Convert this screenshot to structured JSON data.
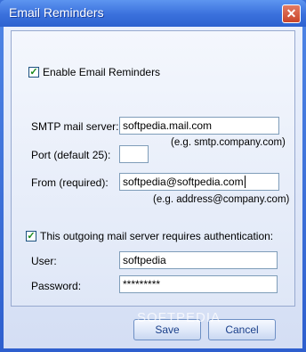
{
  "window": {
    "title": "Email Reminders"
  },
  "enable_reminders": {
    "label": "Enable Email Reminders",
    "checked": true
  },
  "smtp": {
    "label": "SMTP mail server:",
    "value": "softpedia.mail.com",
    "hint": "(e.g. smtp.company.com)"
  },
  "port": {
    "label": "Port (default 25):",
    "value": ""
  },
  "from": {
    "label": "From (required):",
    "value": "softpedia@softpedia.com",
    "hint": "(e.g. address@company.com)"
  },
  "auth": {
    "label": "This outgoing mail server requires authentication:",
    "checked": true
  },
  "user": {
    "label": "User:",
    "value": "softpedia"
  },
  "password": {
    "label": "Password:",
    "value": "*********"
  },
  "buttons": {
    "save": "Save",
    "cancel": "Cancel"
  },
  "watermark": "SOFTPEDIA",
  "icons": {
    "mascot": "yellow-character-with-envelope-icon",
    "mail": "envelope-checkmark-icon"
  }
}
